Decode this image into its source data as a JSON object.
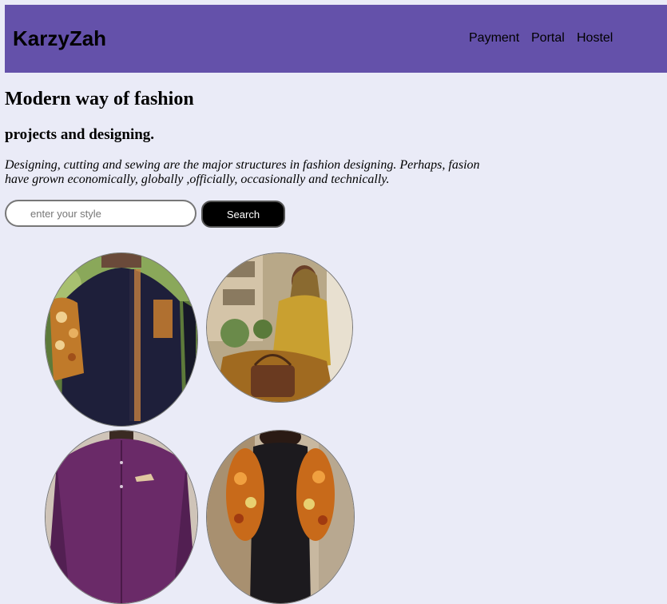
{
  "header": {
    "brand": "KarzyZah",
    "nav": [
      {
        "label": "Payment"
      },
      {
        "label": "Portal"
      },
      {
        "label": "Hostel"
      }
    ]
  },
  "main": {
    "title": "Modern way of fashion",
    "subtitle": "projects and designing.",
    "description": "Designing, cutting and sewing are the major structures in fashion designing. Perhaps, fasion have grown economically, globally ,officially, occasionally and technically.",
    "search": {
      "placeholder": "enter your style",
      "value": "",
      "button_label": "Search"
    }
  },
  "colors": {
    "navbar": "#6451aa",
    "page_background": "#eaebf7",
    "button": "#000000"
  }
}
